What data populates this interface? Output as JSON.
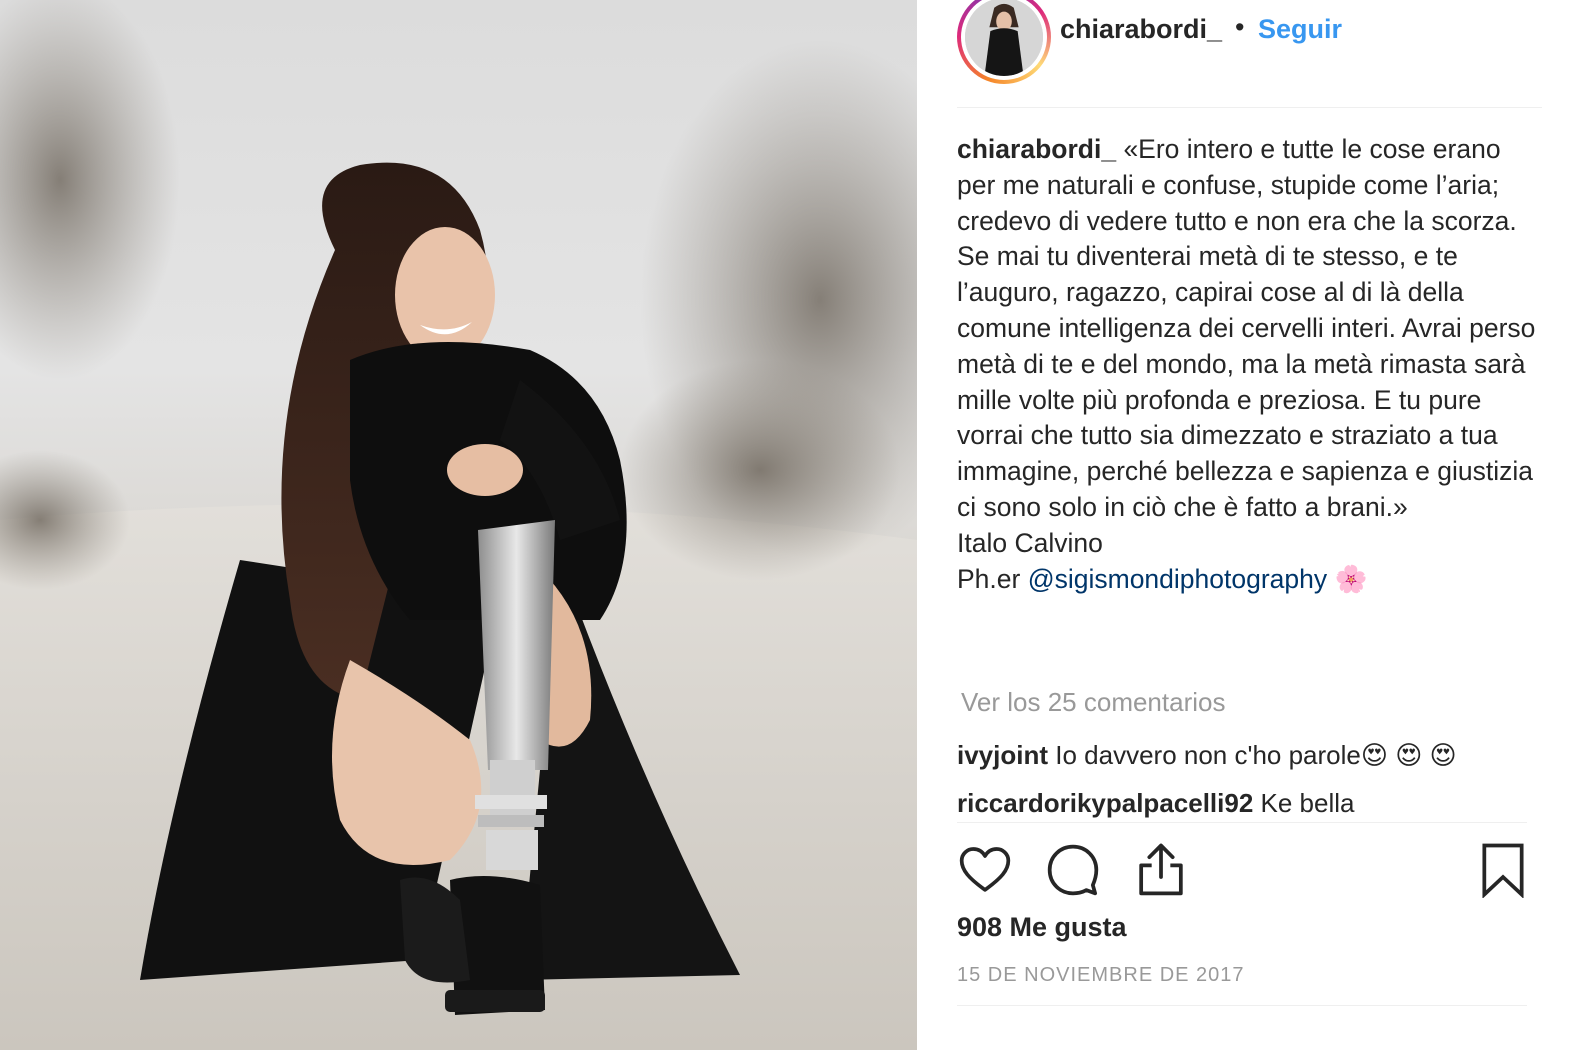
{
  "photo": {
    "description_icon": "photo-icon"
  },
  "header": {
    "username": "chiarabordi_",
    "dot": "•",
    "follow_label": "Seguir"
  },
  "caption": {
    "username": "chiarabordi_",
    "text": "«Ero intero e tutte le cose erano per me naturali e confuse, stupide come l’aria; credevo di vedere tutto e non era che la scorza. Se mai tu diventerai metà di te stesso, e te l’auguro, ragazzo, capirai cose al di là della comune intelligenza dei cervelli interi. Avrai perso metà di te e del mondo, ma la metà rimasta sarà mille volte più profonda e preziosa. E tu pure vorrai che tutto sia dimezzato e straziato a tua immagine, perché bellezza e sapienza e giustizia ci sono solo in ciò che è fatto a brani.»",
    "author": "Italo Calvino",
    "credit_prefix": "Ph.er ",
    "credit_mention": "@sigismondiphotography",
    "credit_emoji": "🌸"
  },
  "view_all_comments": "Ver los 25 comentarios",
  "comments": [
    {
      "username": "ivyjoint",
      "text": "Io davvero non c'ho parole😍 😍 😍"
    },
    {
      "username": "riccardorikypalpacelli92",
      "text": "Ke bella"
    }
  ],
  "actions": {
    "like_icon": "heart-icon",
    "comment_icon": "comment-icon",
    "share_icon": "share-icon",
    "save_icon": "bookmark-icon"
  },
  "likes": "908 Me gusta",
  "date": "15 DE NOVIEMBRE DE 2017"
}
